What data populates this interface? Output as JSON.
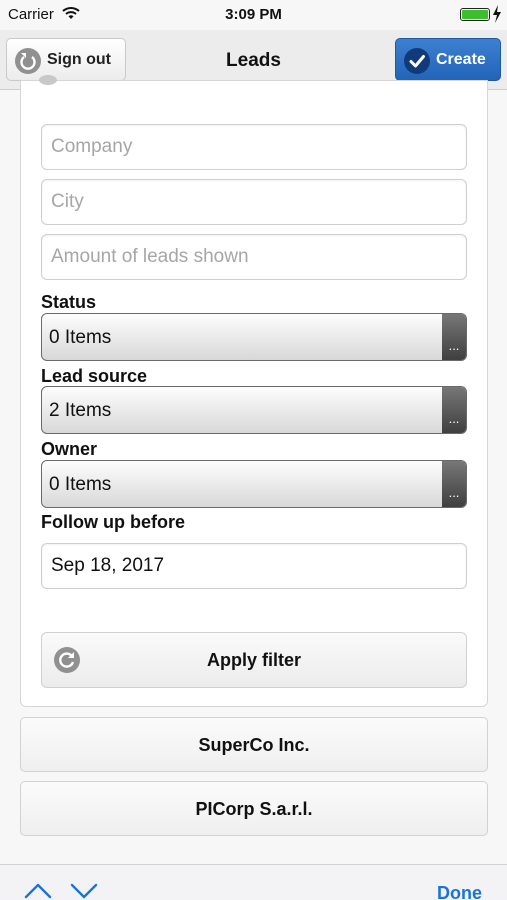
{
  "status_bar": {
    "carrier": "Carrier",
    "time": "3:09 PM",
    "battery_level": 1.0,
    "icons": [
      "wifi-icon",
      "battery-icon",
      "charging-bolt-icon"
    ]
  },
  "navbar": {
    "title": "Leads",
    "sign_out_label": "Sign out",
    "create_label": "Create",
    "sign_out_icon": "back-arrow-icon",
    "create_icon": "checkmark-icon"
  },
  "filter": {
    "company_placeholder": "Company",
    "city_placeholder": "City",
    "amount_placeholder": "Amount of leads shown",
    "status_label": "Status",
    "status_value": "0 Items",
    "lead_source_label": "Lead source",
    "lead_source_value": "2 Items",
    "owner_label": "Owner",
    "owner_value": "0 Items",
    "follow_up_label": "Follow up before",
    "follow_up_value": "Sep 18, 2017",
    "more_glyph": "...",
    "apply_label": "Apply filter",
    "apply_icon": "refresh-icon"
  },
  "leads": [
    {
      "name": "SuperCo Inc."
    },
    {
      "name": "PICorp S.a.r.l."
    }
  ],
  "keyboard_bar": {
    "done_label": "Done",
    "icons": [
      "chevron-up-icon",
      "chevron-down-icon"
    ]
  },
  "colors": {
    "accent": "#2265b8",
    "done": "#1a73d8",
    "battery": "#3cbe2e"
  }
}
